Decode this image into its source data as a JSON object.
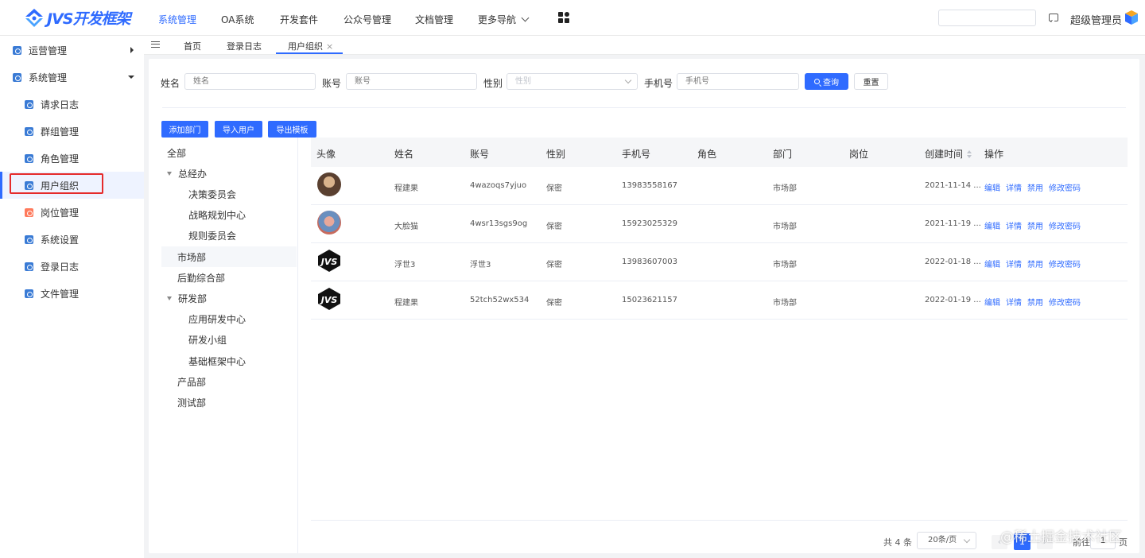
{
  "brand": {
    "logo_text": "JVS开发框架",
    "color": "#2f6bff"
  },
  "topnav": {
    "items": [
      "系统管理",
      "OA系统",
      "开发套件",
      "公众号管理",
      "文档管理",
      "更多导航"
    ],
    "active_index": 0,
    "apps_icon": "apps-grid-icon"
  },
  "header": {
    "search_value": "",
    "message_icon": "message-icon",
    "user_name": "超级管理员"
  },
  "sidebar": {
    "groups": [
      {
        "label": "运营管理",
        "expanded": false
      },
      {
        "label": "系统管理",
        "expanded": true
      }
    ],
    "items": [
      "请求日志",
      "群组管理",
      "角色管理",
      "用户组织",
      "岗位管理",
      "系统设置",
      "登录日志",
      "文件管理"
    ],
    "active_item": "用户组织"
  },
  "tabs": {
    "items": [
      "首页",
      "登录日志",
      "用户组织"
    ],
    "active": "用户组织",
    "close_glyph": "×"
  },
  "filters": {
    "name_label": "姓名",
    "name_placeholder": "姓名",
    "account_label": "账号",
    "account_placeholder": "账号",
    "gender_label": "性别",
    "gender_placeholder": "性别",
    "phone_label": "手机号",
    "phone_placeholder": "手机号",
    "search_button": "查询",
    "reset_button": "重置"
  },
  "actions": {
    "add_dept": "添加部门",
    "import_users": "导入用户",
    "export_template": "导出模板"
  },
  "tree": {
    "nodes": [
      {
        "label": "全部",
        "depth": 0,
        "expanded": null
      },
      {
        "label": "总经办",
        "depth": 1,
        "expanded": true
      },
      {
        "label": "决策委员会",
        "depth": 2,
        "expanded": null
      },
      {
        "label": "战略规划中心",
        "depth": 2,
        "expanded": null
      },
      {
        "label": "规则委员会",
        "depth": 2,
        "expanded": null
      },
      {
        "label": "市场部",
        "depth": 1,
        "expanded": null,
        "selected": true
      },
      {
        "label": "后勤综合部",
        "depth": 1,
        "expanded": null
      },
      {
        "label": "研发部",
        "depth": 1,
        "expanded": true
      },
      {
        "label": "应用研发中心",
        "depth": 2,
        "expanded": null
      },
      {
        "label": "研发小组",
        "depth": 2,
        "expanded": null
      },
      {
        "label": "基础框架中心",
        "depth": 2,
        "expanded": null
      },
      {
        "label": "产品部",
        "depth": 1,
        "expanded": null
      },
      {
        "label": "测试部",
        "depth": 1,
        "expanded": null
      }
    ]
  },
  "table": {
    "columns": [
      "头像",
      "姓名",
      "账号",
      "性别",
      "手机号",
      "角色",
      "部门",
      "岗位",
      "创建时间",
      "操作"
    ],
    "rows": [
      {
        "avatar": "photo-avatar",
        "name": "程建果",
        "account": "4wazoqs7yjuo",
        "gender": "保密",
        "phone": "13983558167",
        "role": "",
        "dept": "市场部",
        "post": "",
        "created": "2021-11-14 ..."
      },
      {
        "avatar": "photo-avatar",
        "name": "大脸猫",
        "account": "4wsr13sgs9og",
        "gender": "保密",
        "phone": "15923025329",
        "role": "",
        "dept": "市场部",
        "post": "",
        "created": "2021-11-19 ..."
      },
      {
        "avatar": "jvs-logo-avatar",
        "name": "浮世3",
        "account": "浮世3",
        "gender": "保密",
        "phone": "13983607003",
        "role": "",
        "dept": "市场部",
        "post": "",
        "created": "2022-01-18 ..."
      },
      {
        "avatar": "jvs-logo-avatar",
        "name": "程建果",
        "account": "52tch52wx534",
        "gender": "保密",
        "phone": "15023621157",
        "role": "",
        "dept": "市场部",
        "post": "",
        "created": "2022-01-19 ..."
      }
    ],
    "row_actions": [
      "编辑",
      "详情",
      "禁用",
      "修改密码"
    ]
  },
  "pagination": {
    "total_text": "共 4 条",
    "page_size": "20条/页",
    "prev": "‹",
    "current_page": "1",
    "next": "›",
    "goto_label": "前往",
    "jump_value": "1",
    "page_unit": "页"
  },
  "watermark": "@稀土掘金技术社区",
  "colors": {
    "primary": "#2f6bff",
    "highlight_box": "#e52b2b"
  }
}
